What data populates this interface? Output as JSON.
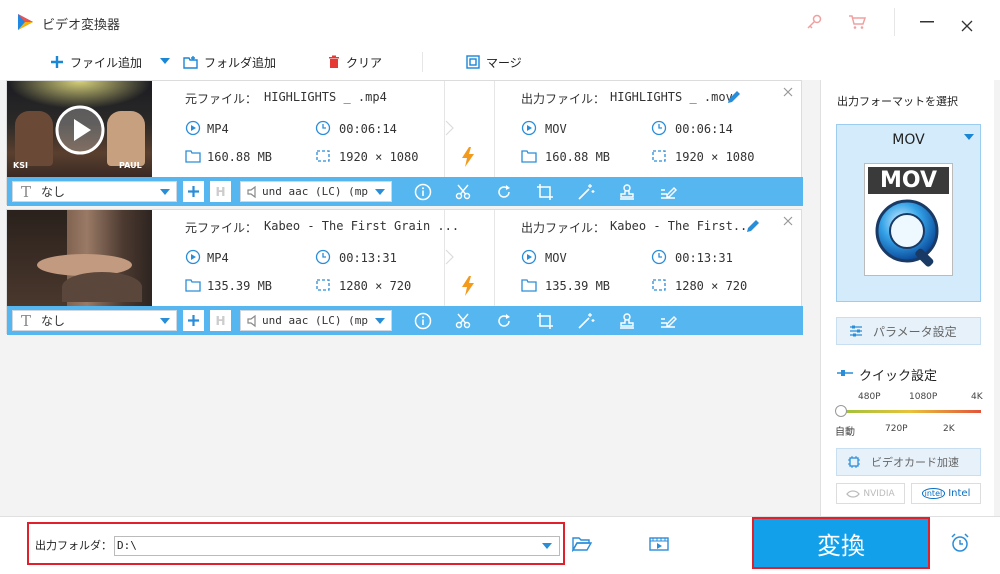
{
  "app": {
    "title": "ビデオ変換器",
    "colors": {
      "accent": "#1a9be0",
      "bar": "#55b6f0",
      "convert": "#12a0ea",
      "highlight_border": "#e0202a",
      "bolt": "#f39a1c"
    }
  },
  "toolbar": {
    "add_file": "ファイル追加",
    "add_folder": "フォルダ追加",
    "clear": "クリア",
    "merge": "マージ"
  },
  "files": [
    {
      "source_label": "元ファイル：",
      "source_name": "HIGHLIGHTS _ .mp4",
      "src_format": "MP4",
      "src_duration": "00:06:14",
      "src_size": "160.88 MB",
      "src_resolution": "1920 × 1080",
      "output_label": "出力ファイル：",
      "output_name": "HIGHLIGHTS _ .mov",
      "out_format": "MOV",
      "out_duration": "00:06:14",
      "out_size": "160.88 MB",
      "out_resolution": "1920 × 1080",
      "thumb_left": "KSI",
      "thumb_right": "PAUL",
      "subtitle": "なし",
      "audio": "und aac (LC) (mp"
    },
    {
      "source_label": "元ファイル：",
      "source_name": "Kabeo - The First Grain ...",
      "src_format": "MP4",
      "src_duration": "00:13:31",
      "src_size": "135.39 MB",
      "src_resolution": "1280 × 720",
      "output_label": "出力ファイル：",
      "output_name": "Kabeo - The First...",
      "out_format": "MOV",
      "out_duration": "00:13:31",
      "out_size": "135.39 MB",
      "out_resolution": "1280 × 720",
      "subtitle": "なし",
      "audio": "und aac (LC) (mp"
    }
  ],
  "sidebar": {
    "select_format_title": "出力フォーマットを選択",
    "format": "MOV",
    "format_icon_text": "MOV",
    "param_settings": "パラメータ設定",
    "quick_settings": "クイック設定",
    "quality_top": [
      "480P",
      "1080P",
      "4K"
    ],
    "quality_bottom": [
      "自動",
      "720P",
      "2K"
    ],
    "quality_value": "自動",
    "gpu_accel": "ビデオカード加速",
    "nvidia": "NVIDIA",
    "intel": "Intel"
  },
  "bottom": {
    "output_folder_label": "出力フォルダ：",
    "output_folder_value": "D:\\",
    "convert": "変換"
  }
}
